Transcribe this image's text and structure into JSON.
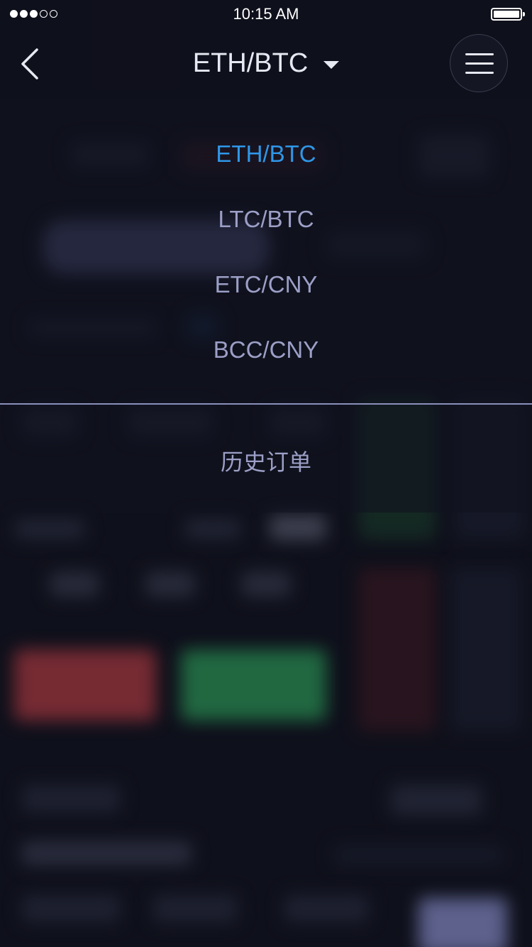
{
  "status_bar": {
    "signal_icon": "signal-dots-icon",
    "signal_bars_filled": 3,
    "signal_bars_total": 5,
    "time": "10:15 AM",
    "battery_icon": "battery-icon",
    "battery_level": 1.0
  },
  "nav": {
    "back_icon": "chevron-left-icon",
    "title": "ETH/BTC",
    "title_caret_icon": "caret-down-icon",
    "menu_icon": "hamburger-menu-icon"
  },
  "dropdown": {
    "pairs": [
      {
        "label": "ETH/BTC",
        "active": true
      },
      {
        "label": "LTC/BTC",
        "active": false
      },
      {
        "label": "ETC/CNY",
        "active": false
      },
      {
        "label": "BCC/CNY",
        "active": false
      }
    ],
    "history_label": "历史订单"
  },
  "colors": {
    "background": "#12131f",
    "active_option": "#2f97e8",
    "inactive_option": "#9c9fc6",
    "divider": "#8a8fbc",
    "buy": "#2e9a5a",
    "sell": "#c23a40"
  }
}
